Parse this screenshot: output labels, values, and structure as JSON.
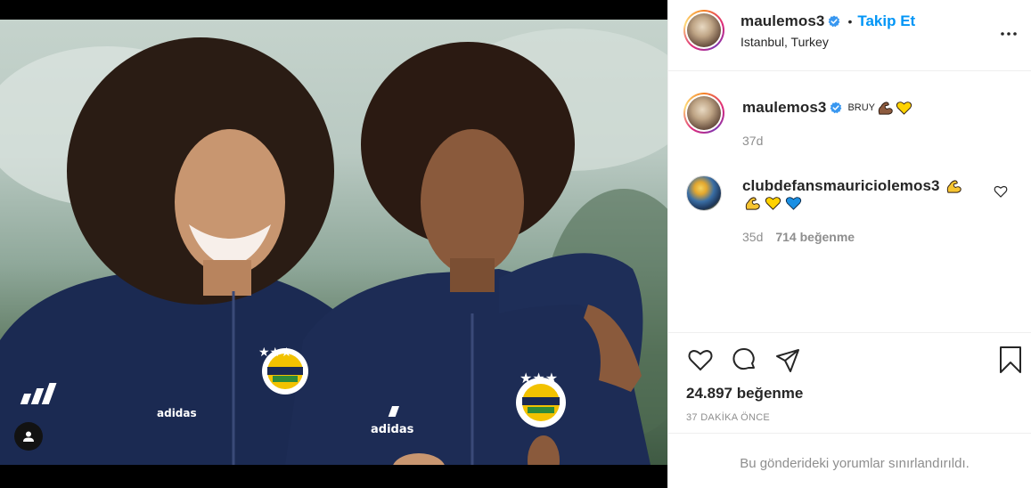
{
  "header": {
    "username": "maulemos3",
    "separator": "•",
    "follow_label": "Takip Et",
    "location": "Istanbul, Turkey",
    "more_icon": "more-horizontal-icon"
  },
  "caption": {
    "username": "maulemos3",
    "text": "BRUY",
    "emojis": [
      "flexed-biceps-medium-dark",
      "yellow-heart"
    ],
    "time": "37d"
  },
  "comment": {
    "username": "clubdefansmauriciolemos3",
    "emojis_inline": [
      "flexed-biceps"
    ],
    "emojis_line2": [
      "flexed-biceps",
      "yellow-heart",
      "blue-heart"
    ],
    "time": "35d",
    "likes": "714 beğenme"
  },
  "post": {
    "likes": "24.897 beğenme",
    "time_ago": "37 DAKİKA ÖNCE",
    "comments_restricted": "Bu gönderideki yorumlar sınırlandırıldı."
  },
  "colors": {
    "accent": "#0095f6",
    "text": "#262626",
    "secondary": "#8e8e8e",
    "verified": "#3897f0",
    "kit_navy": "#1b2a52"
  }
}
